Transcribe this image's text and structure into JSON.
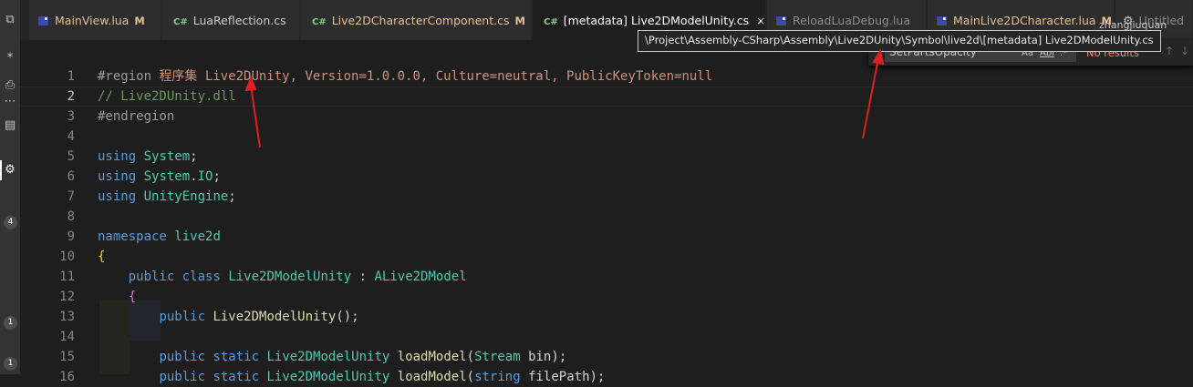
{
  "tabs": [
    {
      "icon": "lua-icon",
      "label": "MainView.lua",
      "status": "M",
      "style": "modified"
    },
    {
      "icon": "csharp-icon",
      "icon_text": "C#",
      "label": "LuaReflection.cs",
      "status": "",
      "style": "normal"
    },
    {
      "icon": "csharp-icon",
      "icon_text": "C#",
      "label": "Live2DCharacterComponent.cs",
      "status": "M",
      "style": "modified"
    },
    {
      "icon": "csharp-icon",
      "icon_text": "C#",
      "label": "[metadata] Live2DModelUnity.cs",
      "status": "",
      "style": "active"
    },
    {
      "icon": "lua-icon",
      "label": "ReloadLuaDebug.lua",
      "status": "",
      "style": "dim"
    },
    {
      "icon": "lua-icon",
      "label": "MainLive2DCharacter.lua",
      "status": "M",
      "style": "modified"
    },
    {
      "icon": "gear-icon",
      "label": "Untitled",
      "status": "",
      "style": "dim"
    }
  ],
  "tab_close_glyph": "×",
  "user_label": "zhangjiuquan",
  "tooltip": "\\Project\\Assembly-CSharp\\Assembly\\Live2DUnity\\Symbol\\live2d\\[metadata] Live2DModelUnity.cs",
  "find": {
    "value": "SetPartsOpacity",
    "match_case": "Aa",
    "whole_word": "Abl",
    "regex": ".*",
    "result": "No results",
    "prev": "↑",
    "next": "↓"
  },
  "activity_badges": [
    "4",
    "1",
    "1"
  ],
  "lines": [
    {
      "n": "1",
      "tokens": [
        [
          "rg",
          "#region "
        ],
        [
          "nm",
          "程序集 Live2DUnity, Version=1.0.0.0, Culture=neutral, PublicKeyToken=null"
        ]
      ]
    },
    {
      "n": "2",
      "current": true,
      "tokens": [
        [
          "cm",
          "// Live2DUnity.dll"
        ]
      ]
    },
    {
      "n": "3",
      "tokens": [
        [
          "rg",
          "#endregion"
        ]
      ]
    },
    {
      "n": "4",
      "tokens": []
    },
    {
      "n": "5",
      "tokens": [
        [
          "kw",
          "using"
        ],
        [
          "pl",
          " "
        ],
        [
          "ty",
          "System"
        ],
        [
          "pl",
          ";"
        ]
      ]
    },
    {
      "n": "6",
      "tokens": [
        [
          "kw",
          "using"
        ],
        [
          "pl",
          " "
        ],
        [
          "ty",
          "System"
        ],
        [
          "pl",
          "."
        ],
        [
          "ty",
          "IO"
        ],
        [
          "pl",
          ";"
        ]
      ]
    },
    {
      "n": "7",
      "tokens": [
        [
          "kw",
          "using"
        ],
        [
          "pl",
          " "
        ],
        [
          "ty",
          "UnityEngine"
        ],
        [
          "pl",
          ";"
        ]
      ]
    },
    {
      "n": "8",
      "tokens": []
    },
    {
      "n": "9",
      "tokens": [
        [
          "kw",
          "namespace"
        ],
        [
          "pl",
          " "
        ],
        [
          "ty",
          "live2d"
        ]
      ]
    },
    {
      "n": "10",
      "tokens": [
        [
          "br",
          "{"
        ]
      ]
    },
    {
      "n": "11",
      "tokens": [
        [
          "pl",
          "    "
        ],
        [
          "kw",
          "public"
        ],
        [
          "pl",
          " "
        ],
        [
          "kw",
          "class"
        ],
        [
          "pl",
          " "
        ],
        [
          "ty",
          "Live2DModelUnity"
        ],
        [
          "pl",
          " : "
        ],
        [
          "ty",
          "ALive2DModel"
        ]
      ]
    },
    {
      "n": "12",
      "tokens": [
        [
          "pl",
          "    "
        ],
        [
          "br2",
          "{"
        ]
      ]
    },
    {
      "n": "13",
      "tokens": [
        [
          "pl",
          "        "
        ],
        [
          "kw",
          "public"
        ],
        [
          "pl",
          " "
        ],
        [
          "fn",
          "Live2DModelUnity"
        ],
        [
          "pl",
          "();"
        ]
      ]
    },
    {
      "n": "14",
      "tokens": []
    },
    {
      "n": "15",
      "tokens": [
        [
          "pl",
          "        "
        ],
        [
          "kw",
          "public"
        ],
        [
          "pl",
          " "
        ],
        [
          "kw",
          "static"
        ],
        [
          "pl",
          " "
        ],
        [
          "ty",
          "Live2DModelUnity"
        ],
        [
          "pl",
          " "
        ],
        [
          "fn",
          "loadModel"
        ],
        [
          "pl",
          "("
        ],
        [
          "ty",
          "Stream"
        ],
        [
          "pl",
          " "
        ],
        [
          "pl",
          "bin);"
        ]
      ]
    },
    {
      "n": "16",
      "tokens": [
        [
          "pl",
          "        "
        ],
        [
          "kw",
          "public"
        ],
        [
          "pl",
          " "
        ],
        [
          "kw",
          "static"
        ],
        [
          "pl",
          " "
        ],
        [
          "ty",
          "Live2DModelUnity"
        ],
        [
          "pl",
          " "
        ],
        [
          "fn",
          "loadModel"
        ],
        [
          "pl",
          "("
        ],
        [
          "kw",
          "string"
        ],
        [
          "pl",
          " filePath);"
        ]
      ]
    }
  ]
}
